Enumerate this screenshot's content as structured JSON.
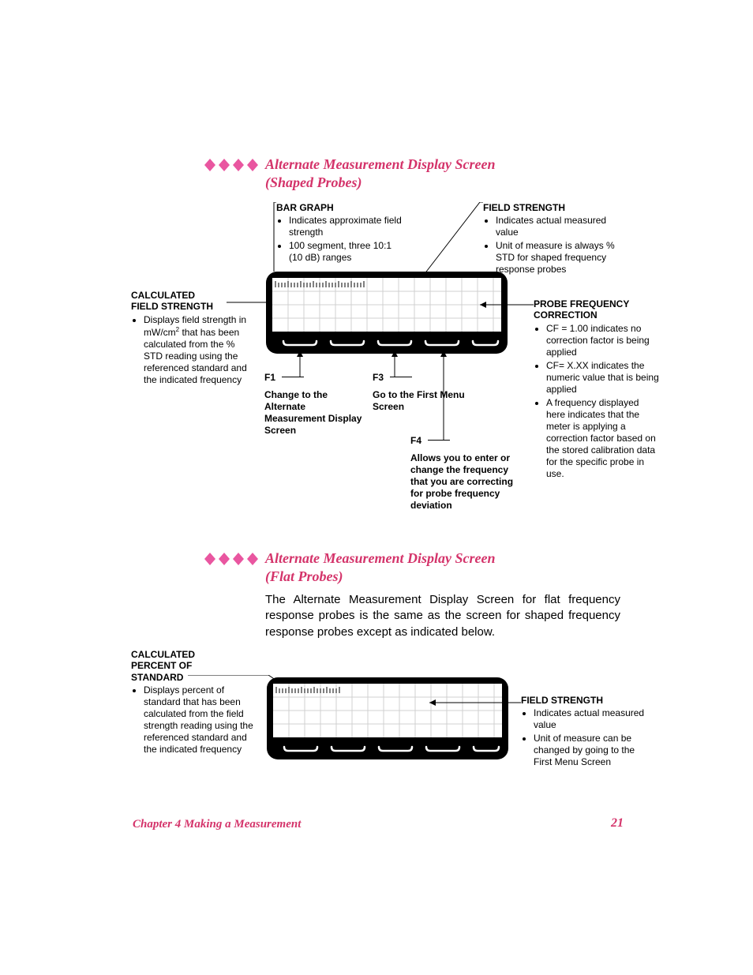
{
  "heading1_line1": "Alternate Measurement Display Screen",
  "heading1_line2": "(Shaped Probes)",
  "heading2_line1": "Alternate Measurement Display Screen",
  "heading2_line2": "(Flat Probes)",
  "para2": "The Alternate Measurement Display Screen for flat frequency response probes is the same as the screen for shaped frequency response probes except as indicated below.",
  "footer_left": "Chapter 4    Making a Measurement",
  "footer_right": "21",
  "bar_graph_title": "BAR GRAPH",
  "bar_graph_b1": "Indicates approximate field strength",
  "bar_graph_b2": "100 segment, three 10:1 (10 dB) ranges",
  "field_strength_title": "FIELD STRENGTH",
  "field_strength_b1": "Indicates actual measured value",
  "field_strength_b2": "Unit of measure is always % STD for shaped frequency response probes",
  "calc_fs_title_l1": "CALCULATED",
  "calc_fs_title_l2": "FIELD STRENGTH",
  "calc_fs_b1_a": "Displays field strength in mW/cm",
  "calc_fs_b1_b": " that has been calculated from the % STD reading using the referenced standard and the indicated frequency",
  "probe_cf_title_l1": "PROBE FREQUENCY",
  "probe_cf_title_l2": "CORRECTION",
  "probe_cf_b1": "CF = 1.00 indicates no correction factor is being applied",
  "probe_cf_b2": "CF= X.XX indicates the numeric value that is being applied",
  "probe_cf_b3": "A frequency displayed here indicates that the meter is applying a correction factor based on the stored calibration data for the specific probe in use.",
  "f1_label": "F1",
  "f1_desc": "Change to the Alternate Measurement Display Screen",
  "f3_label": "F3",
  "f3_desc": "Go to the First Menu Screen",
  "f4_label": "F4",
  "f4_desc": "Allows you to enter or change the frequency that you are correcting for probe frequency deviation",
  "calc_pct_title_l1": "CALCULATED",
  "calc_pct_title_l2": "PERCENT OF",
  "calc_pct_title_l3": "STANDARD",
  "calc_pct_b1": "Displays percent of standard that has been calculated from the field strength reading using the referenced standard and the indicated frequency",
  "field_strength2_title": "FIELD STRENGTH",
  "field_strength2_b1": "Indicates actual measured value",
  "field_strength2_b2": "Unit of measure can be changed by going to the First Menu Screen"
}
